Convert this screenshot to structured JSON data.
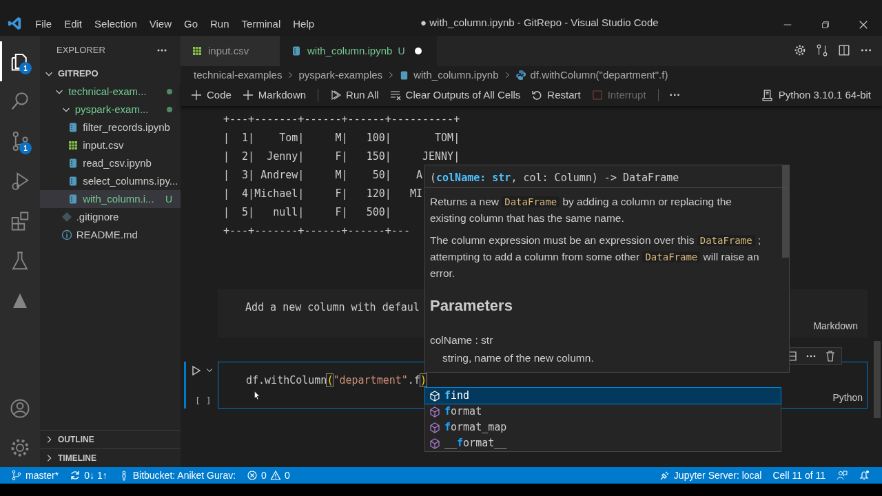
{
  "title_bar": {
    "menu": [
      "File",
      "Edit",
      "Selection",
      "View",
      "Go",
      "Run",
      "Terminal",
      "Help"
    ],
    "title": "● with_column.ipynb - GitRepo - Visual Studio Code"
  },
  "activity_bar": {
    "items": [
      {
        "kind": "files",
        "badge": "1",
        "selected": true
      },
      {
        "kind": "search",
        "selected": false
      },
      {
        "kind": "source-control",
        "badge": "1",
        "selected": false
      },
      {
        "kind": "run",
        "selected": false
      },
      {
        "kind": "extensions",
        "selected": false
      },
      {
        "kind": "testing",
        "selected": false
      },
      {
        "kind": "azure",
        "selected": false
      }
    ],
    "bottom": [
      {
        "kind": "account"
      },
      {
        "kind": "settings"
      }
    ]
  },
  "sidebar": {
    "title": "EXPLORER",
    "root": {
      "label": "GITREPO",
      "expanded": true,
      "children": [
        {
          "label": "technical-exam...",
          "kind": "folder",
          "expanded": true,
          "modified": true,
          "selected": false,
          "children": [
            {
              "label": "pyspark-exam...",
              "kind": "folder",
              "expanded": true,
              "modified": true,
              "selected": false,
              "children": [
                {
                  "label": "filter_records.ipynb",
                  "kind": "notebook",
                  "selected": false
                },
                {
                  "label": "input.csv",
                  "kind": "csv",
                  "selected": false
                },
                {
                  "label": "read_csv.ipynb",
                  "kind": "notebook",
                  "selected": false
                },
                {
                  "label": "select_columns.ipy...",
                  "kind": "notebook",
                  "selected": false
                },
                {
                  "label": "with_column.i...",
                  "kind": "notebook",
                  "badge": "U",
                  "selected": true
                }
              ]
            },
            {
              "label": ".gitignore",
              "kind": "git",
              "selected": false
            },
            {
              "label": "README.md",
              "kind": "info",
              "selected": false
            }
          ]
        }
      ]
    },
    "sections": [
      {
        "label": "OUTLINE",
        "expanded": false
      },
      {
        "label": "TIMELINE",
        "expanded": false
      }
    ]
  },
  "tabs": [
    {
      "label": "input.csv",
      "kind": "csv",
      "selected": false
    },
    {
      "label": "with_column.ipynb",
      "kind": "notebook",
      "badge": "U",
      "dirty": true,
      "selected": true
    }
  ],
  "breadcrumbs": [
    {
      "label": "technical-examples",
      "kind": "text"
    },
    {
      "label": "pyspark-examples",
      "kind": "text"
    },
    {
      "label": "with_column.ipynb",
      "kind": "notebook"
    },
    {
      "label": "df.withColumn(\"department\".f)",
      "kind": "python"
    }
  ],
  "toolbar": {
    "actions": [
      {
        "kind": "add",
        "label": "Code",
        "disabled": false
      },
      {
        "kind": "add",
        "label": "Markdown",
        "disabled": false
      },
      {
        "kind": "run-all",
        "label": "Run All",
        "disabled": false
      },
      {
        "kind": "clear",
        "label": "Clear Outputs of All Cells",
        "disabled": false
      },
      {
        "kind": "restart",
        "label": "Restart",
        "disabled": false
      },
      {
        "kind": "interrupt",
        "label": "Interrupt",
        "disabled": true
      }
    ],
    "more": "···",
    "kernel": "Python 3.10.1 64-bit"
  },
  "output": {
    "lines": [
      "+---+-------+------+------+----------+",
      "|  1|    Tom|     M|   100|       TOM|",
      "|  2|  Jenny|     F|   150|     JENNY|",
      "|  3| Andrew|     M|    50|    A",
      "|  4|Michael|     F|   120|   MI",
      "|  5|   null|     F|   500|",
      "+---+-------+------+------+---"
    ]
  },
  "markdown_cell": {
    "text": "Add a new column with defaul",
    "language": "Markdown"
  },
  "code_cell": {
    "tokens": [
      {
        "text": "df.withColumn",
        "kind": "plain"
      },
      {
        "text": "(",
        "kind": "bracket"
      },
      {
        "text": "\"department\"",
        "kind": "string"
      },
      {
        "text": ".f",
        "kind": "plain"
      },
      {
        "text": ")",
        "kind": "bracket"
      }
    ],
    "execution": "[ ]",
    "language": "Python"
  },
  "hover": {
    "signature": [
      {
        "text": "(",
        "kind": "plain"
      },
      {
        "text": "colName:",
        "kind": "param"
      },
      {
        "text": " str",
        "kind": "type"
      },
      {
        "text": ", col: Column) -> DataFrame",
        "kind": "plain"
      }
    ],
    "paragraphs": [
      [
        {
          "text": "Returns a new ",
          "code": false
        },
        {
          "text": "DataFrame",
          "code": true
        },
        {
          "text": " by adding a column or replacing the existing column that has the same name.",
          "code": false
        }
      ],
      [
        {
          "text": "The column expression must be an expression over this ",
          "code": false
        },
        {
          "text": "DataFrame",
          "code": true
        },
        {
          "text": " ; attempting to add a column from some other ",
          "code": false
        },
        {
          "text": "DataFrame",
          "code": true
        },
        {
          "text": " will raise an error.",
          "code": false
        }
      ]
    ],
    "heading": "Parameters",
    "param": "colName : str",
    "param_description": "string, name of the new column."
  },
  "suggestions": [
    {
      "match": "f",
      "rest": "ind",
      "selected": true
    },
    {
      "match": "f",
      "rest": "ormat",
      "selected": false
    },
    {
      "match": "f",
      "rest": "ormat_map",
      "selected": false
    },
    {
      "prefix": "__",
      "match": "f",
      "rest": "ormat__",
      "selected": false
    }
  ],
  "status_bar": {
    "left": [
      {
        "kind": "branch",
        "label": "master*"
      },
      {
        "kind": "sync",
        "label": "0↓ 1↑"
      },
      {
        "kind": "person",
        "label": "Bitbucket: Aniket Gurav:"
      },
      {
        "kind": "problems",
        "errors": "0",
        "warnings": "0"
      }
    ],
    "right": [
      {
        "kind": "jupyter",
        "label": "Jupyter Server: local"
      },
      {
        "kind": "text",
        "label": "Cell 11 of 11"
      },
      {
        "kind": "feedback"
      },
      {
        "kind": "bell"
      }
    ]
  }
}
